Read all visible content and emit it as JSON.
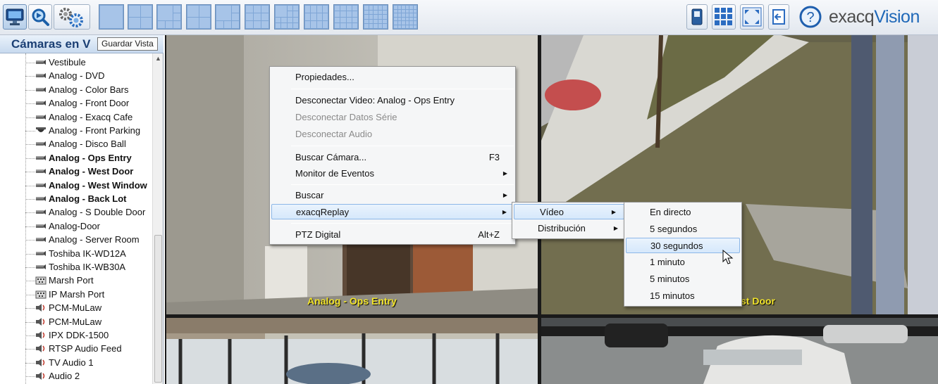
{
  "toolbar": {
    "logo_text_a": "exacq",
    "logo_text_b": "Vision",
    "help_glyph": "?",
    "left_icons": [
      "monitor-icon",
      "search-icon",
      "gears-icon"
    ],
    "layouts": [
      "1x1",
      "2x2",
      "1+5",
      "1+7",
      "1+3",
      "3x3",
      "3x3b",
      "4x3",
      "4x4",
      "5x5"
    ],
    "right_icons": [
      "single-camera-icon",
      "grid-view-icon",
      "fullscreen-icon",
      "back-icon",
      "help-icon"
    ]
  },
  "sidebar": {
    "title": "Cámaras en V",
    "tooltip": "Guardar Vista",
    "items": [
      {
        "label": "Vestibule",
        "icon": "camera-icon",
        "bold": false
      },
      {
        "label": "Analog - DVD",
        "icon": "camera-icon",
        "bold": false
      },
      {
        "label": "Analog - Color Bars",
        "icon": "camera-icon",
        "bold": false
      },
      {
        "label": "Analog - Front Door",
        "icon": "camera-icon",
        "bold": false
      },
      {
        "label": "Analog - Exacq Cafe",
        "icon": "camera-icon",
        "bold": false
      },
      {
        "label": "Analog - Front Parking",
        "icon": "dome-camera-icon",
        "bold": false
      },
      {
        "label": "Analog - Disco Ball",
        "icon": "camera-icon",
        "bold": false
      },
      {
        "label": "Analog - Ops Entry",
        "icon": "camera-icon",
        "bold": true
      },
      {
        "label": "Analog - West Door",
        "icon": "camera-icon",
        "bold": true
      },
      {
        "label": "Analog - West Window",
        "icon": "camera-icon",
        "bold": true
      },
      {
        "label": "Analog - Back Lot",
        "icon": "camera-icon",
        "bold": true
      },
      {
        "label": "Analog - S Double Door",
        "icon": "camera-icon",
        "bold": false
      },
      {
        "label": "Analog-Door",
        "icon": "camera-icon",
        "bold": false
      },
      {
        "label": "Analog - Server Room",
        "icon": "camera-icon",
        "bold": false
      },
      {
        "label": "Toshiba IK-WD12A",
        "icon": "camera-icon",
        "bold": false
      },
      {
        "label": "Toshiba IK-WB30A",
        "icon": "camera-icon",
        "bold": false
      },
      {
        "label": "Marsh Port",
        "icon": "serial-port-icon",
        "bold": false
      },
      {
        "label": "IP Marsh Port",
        "icon": "serial-port-icon",
        "bold": false
      },
      {
        "label": "PCM-MuLaw",
        "icon": "audio-icon",
        "bold": false
      },
      {
        "label": "PCM-MuLaw",
        "icon": "audio-icon",
        "bold": false
      },
      {
        "label": "IPX DDK-1500",
        "icon": "audio-icon",
        "bold": false
      },
      {
        "label": "RTSP Audio Feed",
        "icon": "audio-icon",
        "bold": false
      },
      {
        "label": "TV Audio 1",
        "icon": "audio-icon",
        "bold": false
      },
      {
        "label": "Audio 2",
        "icon": "audio-icon",
        "bold": false
      }
    ]
  },
  "video_tiles": [
    {
      "label": "Analog - Ops Entry"
    },
    {
      "label": "st Door"
    },
    {
      "label": ""
    },
    {
      "label": ""
    }
  ],
  "context_menu": {
    "items": [
      {
        "label": "Propiedades...",
        "disabled": false,
        "shortcut": "",
        "submenu": false
      },
      {
        "label": "Desconectar Video: Analog - Ops Entry",
        "disabled": false,
        "shortcut": "",
        "submenu": false
      },
      {
        "label": "Desconectar Datos Série",
        "disabled": true,
        "shortcut": "",
        "submenu": false
      },
      {
        "label": "Desconectar Audio",
        "disabled": true,
        "shortcut": "",
        "submenu": false
      },
      {
        "label": "Buscar Cámara...",
        "disabled": false,
        "shortcut": "F3",
        "submenu": false
      },
      {
        "label": "Monitor de Eventos",
        "disabled": false,
        "shortcut": "",
        "submenu": true
      },
      {
        "label": "Buscar",
        "disabled": false,
        "shortcut": "",
        "submenu": true
      },
      {
        "label": "exacqReplay",
        "disabled": false,
        "shortcut": "",
        "submenu": true,
        "highlighted": true
      },
      {
        "label": "PTZ Digital",
        "disabled": false,
        "shortcut": "Alt+Z",
        "submenu": false
      }
    ]
  },
  "replay_submenu": {
    "items": [
      {
        "label": "Vídeo",
        "submenu": true,
        "highlighted": true
      },
      {
        "label": "Distribución",
        "submenu": true,
        "highlighted": false
      }
    ]
  },
  "video_submenu": {
    "items": [
      {
        "label": "En directo",
        "highlighted": false
      },
      {
        "label": "5 segundos",
        "highlighted": false
      },
      {
        "label": "30 segundos",
        "highlighted": true
      },
      {
        "label": "1 minuto",
        "highlighted": false
      },
      {
        "label": "5 minutos",
        "highlighted": false
      },
      {
        "label": "15 minutos",
        "highlighted": false
      }
    ]
  },
  "colors": {
    "accent": "#1b3f74",
    "overlay_label": "#f1e32a",
    "menu_highlight": "#d6e8fb"
  }
}
